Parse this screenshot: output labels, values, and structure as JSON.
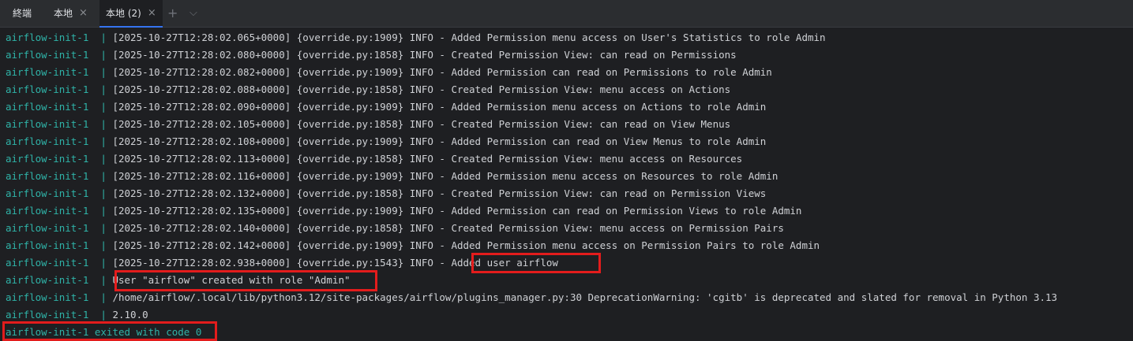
{
  "tabs": {
    "title": "終端",
    "items": [
      {
        "label": "本地",
        "close": "×"
      },
      {
        "label": "本地 (2)",
        "close": "×"
      }
    ],
    "new_tab": "+",
    "dropdown": "⌵"
  },
  "terminal": {
    "lines": [
      {
        "service": "airflow-init-1",
        "sep": "|",
        "text": "[2025-10-27T12:28:02.065+0000] {override.py:1909} INFO - Added Permission menu access on User's Statistics to role Admin"
      },
      {
        "service": "airflow-init-1",
        "sep": "|",
        "text": "[2025-10-27T12:28:02.080+0000] {override.py:1858} INFO - Created Permission View: can read on Permissions"
      },
      {
        "service": "airflow-init-1",
        "sep": "|",
        "text": "[2025-10-27T12:28:02.082+0000] {override.py:1909} INFO - Added Permission can read on Permissions to role Admin"
      },
      {
        "service": "airflow-init-1",
        "sep": "|",
        "text": "[2025-10-27T12:28:02.088+0000] {override.py:1858} INFO - Created Permission View: menu access on Actions"
      },
      {
        "service": "airflow-init-1",
        "sep": "|",
        "text": "[2025-10-27T12:28:02.090+0000] {override.py:1909} INFO - Added Permission menu access on Actions to role Admin"
      },
      {
        "service": "airflow-init-1",
        "sep": "|",
        "text": "[2025-10-27T12:28:02.105+0000] {override.py:1858} INFO - Created Permission View: can read on View Menus"
      },
      {
        "service": "airflow-init-1",
        "sep": "|",
        "text": "[2025-10-27T12:28:02.108+0000] {override.py:1909} INFO - Added Permission can read on View Menus to role Admin"
      },
      {
        "service": "airflow-init-1",
        "sep": "|",
        "text": "[2025-10-27T12:28:02.113+0000] {override.py:1858} INFO - Created Permission View: menu access on Resources"
      },
      {
        "service": "airflow-init-1",
        "sep": "|",
        "text": "[2025-10-27T12:28:02.116+0000] {override.py:1909} INFO - Added Permission menu access on Resources to role Admin"
      },
      {
        "service": "airflow-init-1",
        "sep": "|",
        "text": "[2025-10-27T12:28:02.132+0000] {override.py:1858} INFO - Created Permission View: can read on Permission Views"
      },
      {
        "service": "airflow-init-1",
        "sep": "|",
        "text": "[2025-10-27T12:28:02.135+0000] {override.py:1909} INFO - Added Permission can read on Permission Views to role Admin"
      },
      {
        "service": "airflow-init-1",
        "sep": "|",
        "text": "[2025-10-27T12:28:02.140+0000] {override.py:1858} INFO - Created Permission View: menu access on Permission Pairs"
      },
      {
        "service": "airflow-init-1",
        "sep": "|",
        "text": "[2025-10-27T12:28:02.142+0000] {override.py:1909} INFO - Added Permission menu access on Permission Pairs to role Admin"
      },
      {
        "service": "airflow-init-1",
        "sep": "|",
        "text": "[2025-10-27T12:28:02.938+0000] {override.py:1543} INFO - Added user airflow"
      },
      {
        "service": "airflow-init-1",
        "sep": "|",
        "text": "User \"airflow\" created with role \"Admin\""
      },
      {
        "service": "airflow-init-1",
        "sep": "|",
        "text": "/home/airflow/.local/lib/python3.12/site-packages/airflow/plugins_manager.py:30 DeprecationWarning: 'cgitb' is deprecated and slated for removal in Python 3.13"
      },
      {
        "service": "airflow-init-1",
        "sep": "|",
        "text": "2.10.0"
      }
    ],
    "exit_line": "airflow-init-1 exited with code 0",
    "highlight_color": "#e31c1c",
    "service_color": "#2fb3a8"
  }
}
